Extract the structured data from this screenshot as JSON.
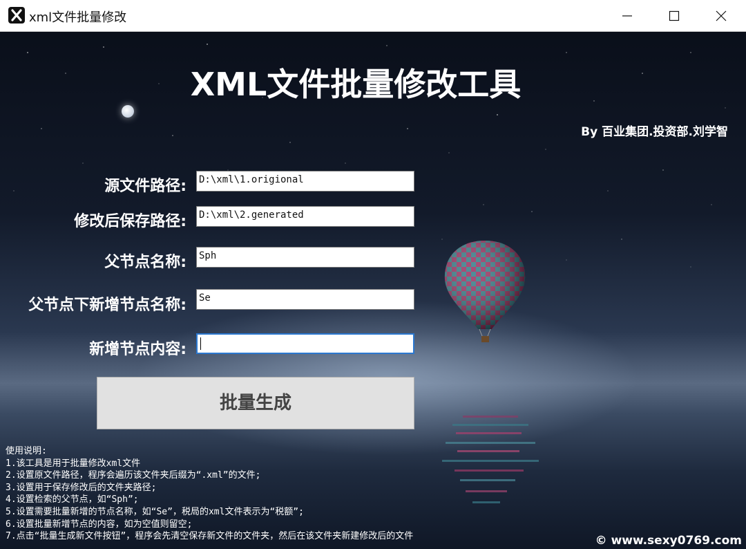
{
  "window": {
    "title": "xml文件批量修改",
    "icon": "app-x-icon"
  },
  "header": {
    "title": "XML文件批量修改工具",
    "author": "By 百业集团.投资部.刘学智"
  },
  "form": {
    "source_path": {
      "label": "源文件路径:",
      "value": "D:\\xml\\1.origional"
    },
    "save_path": {
      "label": "修改后保存路径:",
      "value": "D:\\xml\\2.generated"
    },
    "parent_node": {
      "label": "父节点名称:",
      "value": "Sph"
    },
    "new_node_name": {
      "label": "父节点下新增节点名称:",
      "value": "Se"
    },
    "new_node_content": {
      "label": "新增节点内容:",
      "value": ""
    },
    "generate_button": "批量生成"
  },
  "instructions": [
    "使用说明:",
    "1.该工具是用于批量修改xml文件",
    "2.设置原文件路径，程序会遍历该文件夹后缀为“.xml”的文件;",
    "3.设置用于保存修改后的文件夹路径;",
    "4.设置检索的父节点，如“Sph”;",
    "5.设置需要批量新增的节点名称，如“Se”，税局的xml文件表示为“税额”;",
    "6.设置批量新增节点的内容，如为空值则留空;",
    "7.点击“批量生成新文件按钮”，程序会先清空保存新文件的文件夹，然后在该文件夹新建修改后的文件"
  ],
  "watermark": "© www.sexy0769.com",
  "colors": {
    "focus_border": "#2b78d0",
    "button_bg": "#e1e1e1"
  }
}
